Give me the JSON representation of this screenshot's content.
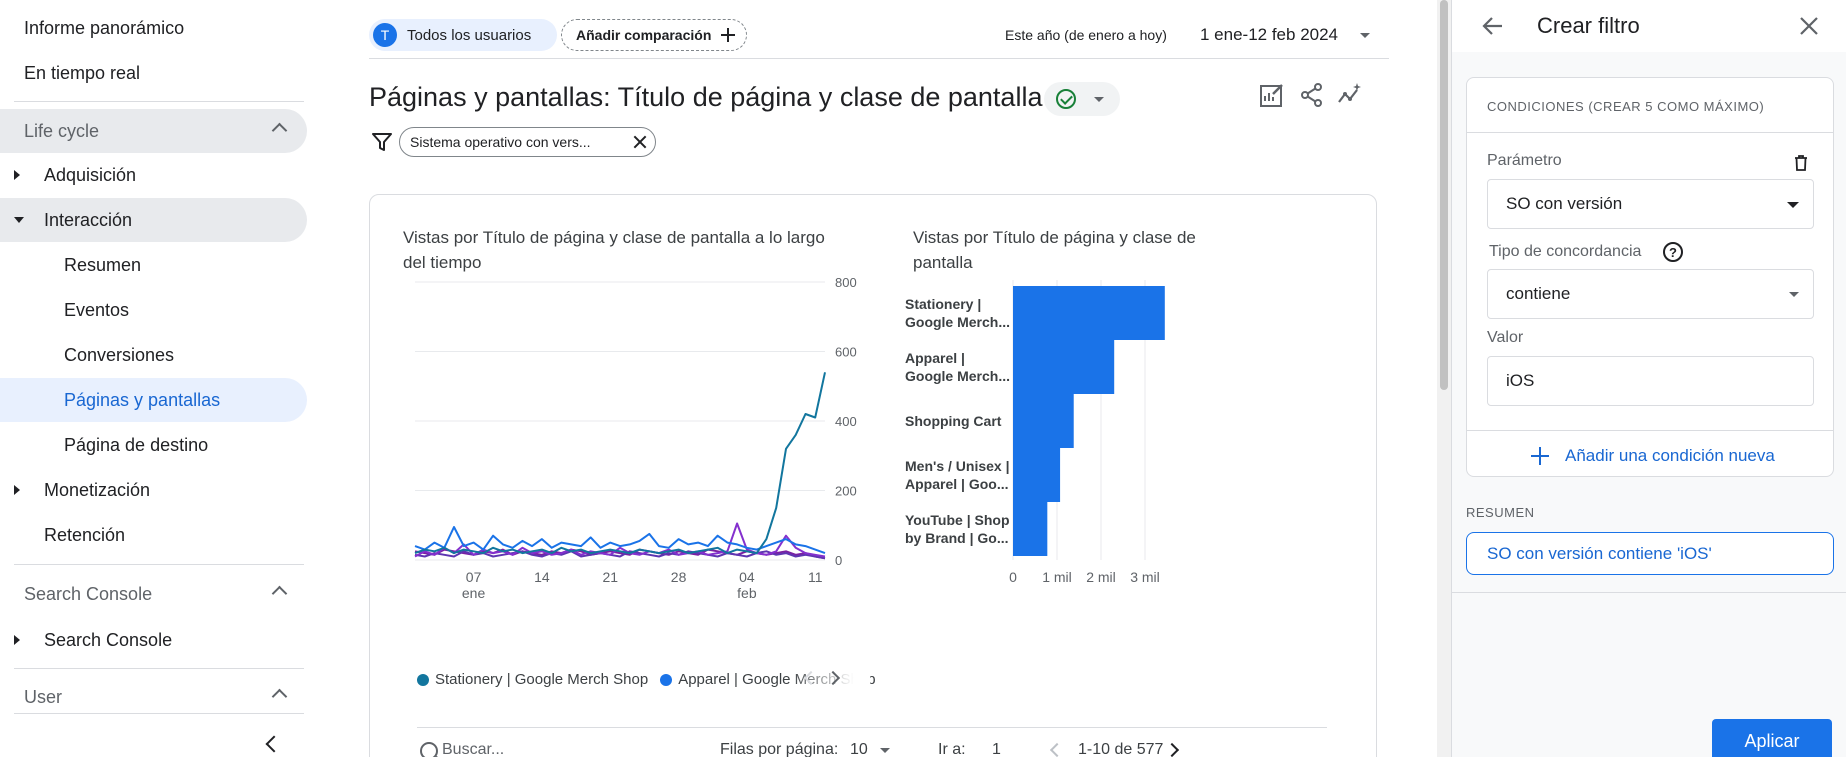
{
  "sidebar": {
    "top_items": [
      "Informe panorámico",
      "En tiempo real"
    ],
    "life_cycle": {
      "header": "Life cycle",
      "items": [
        {
          "label": "Adquisición",
          "level": 1,
          "caret": "right"
        },
        {
          "label": "Interacción",
          "level": 1,
          "caret": "down",
          "highlight": "grey"
        },
        {
          "label": "Resumen",
          "level": 2
        },
        {
          "label": "Eventos",
          "level": 2
        },
        {
          "label": "Conversiones",
          "level": 2
        },
        {
          "label": "Páginas y pantallas",
          "level": 2,
          "highlight": "blue"
        },
        {
          "label": "Página de destino",
          "level": 2
        },
        {
          "label": "Monetización",
          "level": 1,
          "caret": "right"
        },
        {
          "label": "Retención",
          "level": 1
        }
      ]
    },
    "search_console": {
      "header": "Search Console",
      "item": "Search Console"
    },
    "user": {
      "header": "User"
    }
  },
  "top_bar": {
    "user_chip_initial": "T",
    "user_chip": "Todos los usuarios",
    "compare_chip": "Añadir comparación",
    "date_range_label": "Este año (de enero a hoy)",
    "date_range_value": "1 ene-12 feb 2024"
  },
  "report": {
    "title": "Páginas y pantallas: Título de página y clase de pantalla",
    "filter_chip": "Sistema operativo con vers..."
  },
  "chart_data": [
    {
      "type": "line",
      "title": "Vistas por Título de página y clase de pantalla a lo largo del tiempo",
      "x_tick_labels": [
        [
          "07",
          "ene"
        ],
        [
          "14",
          ""
        ],
        [
          "21",
          ""
        ],
        [
          "28",
          ""
        ],
        [
          "04",
          "feb"
        ],
        [
          "11",
          ""
        ]
      ],
      "y_ticks": [
        0,
        200,
        400,
        600,
        800
      ],
      "ylim": [
        0,
        800
      ],
      "y_axis_side": "right",
      "grid": true,
      "x_dates": [
        "01-01",
        "01-02",
        "01-03",
        "01-04",
        "01-05",
        "01-06",
        "01-07",
        "01-08",
        "01-09",
        "01-10",
        "01-11",
        "01-12",
        "01-13",
        "01-14",
        "01-15",
        "01-16",
        "01-17",
        "01-18",
        "01-19",
        "01-20",
        "01-21",
        "01-22",
        "01-23",
        "01-24",
        "01-25",
        "01-26",
        "01-27",
        "01-28",
        "01-29",
        "01-30",
        "01-31",
        "02-01",
        "02-02",
        "02-03",
        "02-04",
        "02-05",
        "02-06",
        "02-07",
        "02-08",
        "02-09",
        "02-10",
        "02-11",
        "02-12"
      ],
      "series": [
        {
          "name": "Stationery | Google Merch Shop",
          "color": "#12769e",
          "values": [
            20,
            30,
            25,
            35,
            20,
            30,
            25,
            20,
            35,
            25,
            30,
            20,
            25,
            30,
            20,
            35,
            25,
            30,
            20,
            25,
            30,
            25,
            20,
            30,
            25,
            20,
            25,
            30,
            20,
            25,
            30,
            35,
            20,
            30,
            25,
            20,
            60,
            150,
            320,
            360,
            420,
            410,
            540
          ]
        },
        {
          "name": "Apparel | Google Merch Shop",
          "color": "#1a73e8",
          "values": [
            40,
            30,
            50,
            35,
            95,
            40,
            50,
            30,
            70,
            45,
            35,
            55,
            40,
            60,
            35,
            50,
            45,
            40,
            65,
            35,
            50,
            40,
            45,
            55,
            75,
            40,
            35,
            60,
            45,
            50,
            40,
            70,
            50,
            45,
            35,
            30,
            40,
            50,
            60,
            45,
            40,
            30,
            20
          ]
        },
        {
          "name": "Shopping Cart",
          "color": "#8430ce",
          "values": [
            10,
            25,
            15,
            35,
            20,
            45,
            15,
            30,
            20,
            25,
            15,
            35,
            20,
            25,
            15,
            20,
            30,
            15,
            25,
            20,
            15,
            35,
            20,
            15,
            25,
            20,
            30,
            15,
            20,
            25,
            15,
            20,
            25,
            105,
            30,
            20,
            15,
            25,
            70,
            35,
            20,
            15,
            10
          ]
        },
        {
          "name": "Men's / Unisex | Apparel | Google Merch Shop",
          "color": "#5e35b1",
          "values": [
            15,
            10,
            20,
            15,
            10,
            25,
            15,
            20,
            10,
            15,
            20,
            25,
            15,
            10,
            20,
            15,
            25,
            10,
            15,
            20,
            15,
            10,
            25,
            20,
            15,
            10,
            20,
            15,
            25,
            20,
            15,
            10,
            20,
            15,
            10,
            20,
            25,
            15,
            20,
            10,
            15,
            10,
            5
          ]
        },
        {
          "name": "YouTube | Shop by Brand | Google Merch Shop",
          "color": "#7b1fa2",
          "values": [
            25,
            20,
            15,
            30,
            25,
            20,
            15,
            25,
            20,
            30,
            15,
            25,
            20,
            15,
            25,
            20,
            30,
            25,
            15,
            20,
            25,
            20,
            15,
            30,
            25,
            20,
            15,
            25,
            20,
            15,
            30,
            25,
            20,
            15,
            25,
            20,
            15,
            20,
            25,
            15,
            20,
            10,
            5
          ]
        }
      ],
      "legend": {
        "position": "bottom",
        "visible_entries": [
          "Stationery | Google Merch Shop",
          "Apparel | Google Merch Shop"
        ]
      }
    },
    {
      "type": "bar",
      "orientation": "horizontal",
      "title": "Vistas por Título de página y clase de pantalla",
      "categories": [
        [
          "Stationery |",
          "Google Merch..."
        ],
        [
          "Apparel |",
          "Google Merch..."
        ],
        [
          "Shopping Cart"
        ],
        [
          "Men's / Unisex |",
          "Apparel | Goo..."
        ],
        [
          "YouTube | Shop",
          "by Brand | Go..."
        ]
      ],
      "values": [
        3450,
        2300,
        1380,
        1070,
        780
      ],
      "x_ticks": [
        0,
        1000,
        2000,
        3000
      ],
      "x_tick_labels": [
        "0",
        "1 mil",
        "2 mil",
        "3 mil"
      ],
      "xlim": [
        0,
        3500
      ],
      "color": "#1a73e8",
      "grid": true
    }
  ],
  "table_toolbar": {
    "search_placeholder": "Buscar...",
    "rows_label": "Filas por página:",
    "rows_value": "10",
    "goto_label": "Ir a:",
    "goto_value": "1",
    "range": "1-10 de 577"
  },
  "filter_panel": {
    "title": "Crear filtro",
    "conditions_header": "CONDICIONES (CREAR 5 COMO MÁXIMO)",
    "param_label": "Parámetro",
    "param_value": "SO con versión",
    "match_label": "Tipo de concordancia",
    "match_value": "contiene",
    "value_label": "Valor",
    "value_value": "iOS",
    "add_condition": "Añadir una condición nueva",
    "summary_label": "RESUMEN",
    "summary_text": "SO con versión contiene 'iOS'",
    "apply": "Aplicar"
  }
}
